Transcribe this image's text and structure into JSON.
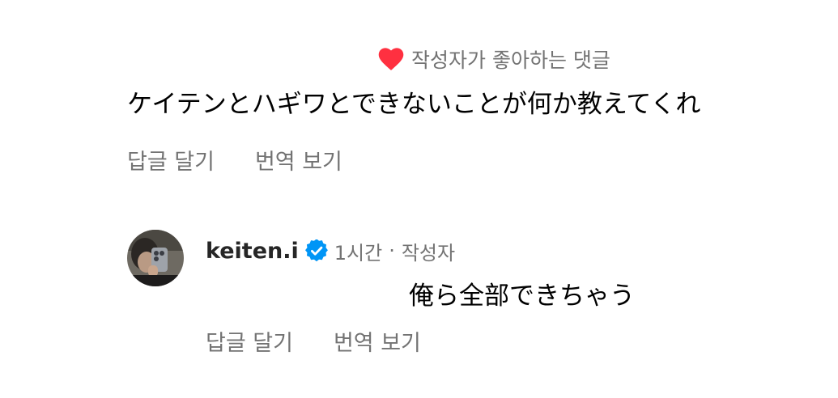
{
  "liked_comment": {
    "liked_by_author_label": "작성자가 좋아하는 댓글",
    "text": "ケイテンとハギワとできないことが何か教えてくれ",
    "reply_label": "답글 달기",
    "translate_label": "번역 보기",
    "heart_icon": "heart-icon",
    "heart_color": "#ff3040"
  },
  "reply": {
    "username": "keiten.i",
    "verified_icon": "verified-badge-icon",
    "verified_color": "#0095f6",
    "time": "1시간",
    "separator": "·",
    "author_tag": "작성자",
    "text": "俺ら全部できちゃう",
    "reply_label": "답글 달기",
    "translate_label": "번역 보기"
  },
  "colors": {
    "text": "#000000",
    "secondary": "#737373"
  }
}
